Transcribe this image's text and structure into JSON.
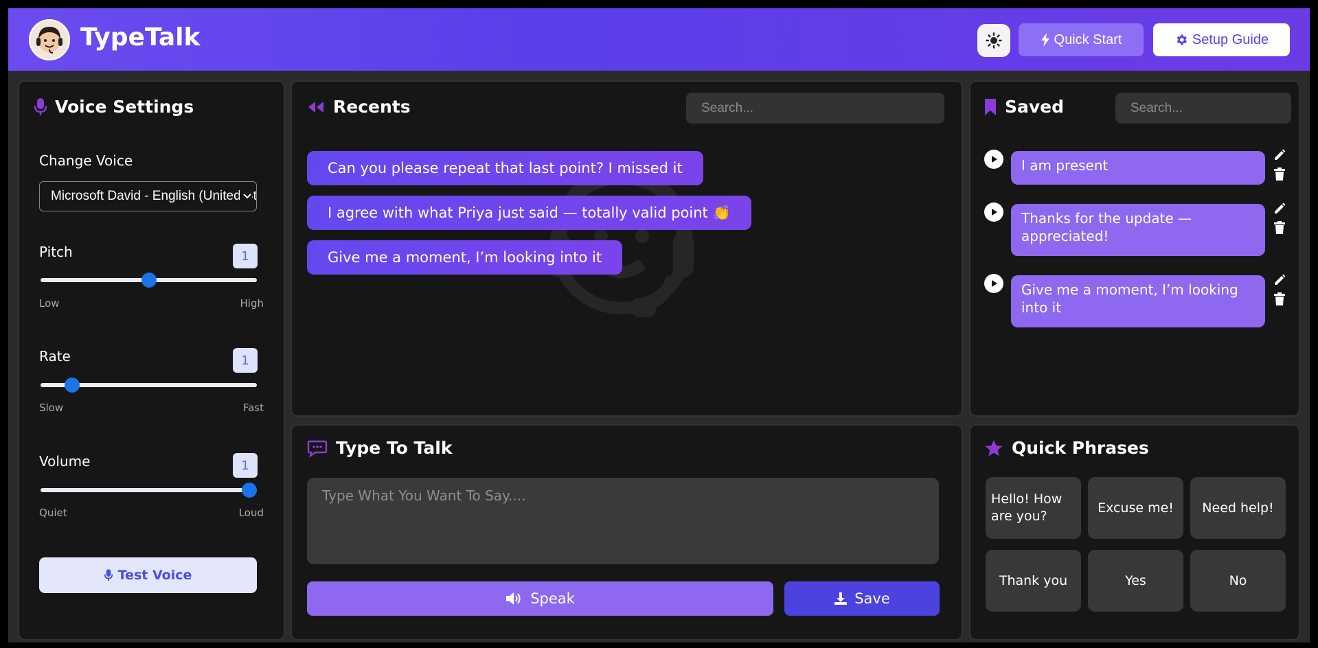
{
  "app": {
    "name": "TypeTalk"
  },
  "header": {
    "quick_start_label": "Quick Start",
    "setup_guide_label": "Setup Guide"
  },
  "voice_settings": {
    "title": "Voice Settings",
    "change_voice_label": "Change Voice",
    "selected_voice": "Microsoft David - English (United States)",
    "pitch": {
      "label": "Pitch",
      "value": "1",
      "level": 0.5,
      "low": "Low",
      "high": "High"
    },
    "rate": {
      "label": "Rate",
      "value": "1",
      "level": 0.12,
      "low": "Slow",
      "high": "Fast"
    },
    "volume": {
      "label": "Volume",
      "value": "1",
      "level": 1.0,
      "low": "Quiet",
      "high": "Loud"
    },
    "test_voice_label": "Test Voice"
  },
  "recents": {
    "title": "Recents",
    "search_placeholder": "Search...",
    "items": [
      "Can you please repeat that last point? I missed it",
      "I agree with what Priya just said — totally valid point 👏",
      "Give me a moment, I’m looking into it"
    ]
  },
  "saved": {
    "title": "Saved",
    "search_placeholder": "Search...",
    "items": [
      "I am present",
      "Thanks for the update — appreciated!",
      "Give me a moment, I’m looking into it"
    ]
  },
  "type_to_talk": {
    "title": "Type To Talk",
    "placeholder": "Type What You Want To Say....",
    "speak_label": "Speak",
    "save_label": "Save"
  },
  "quick_phrases": {
    "title": "Quick Phrases",
    "items": [
      "Hello! How are you?",
      "Excuse me!",
      "Need help!",
      "Thank you",
      "Yes",
      "No"
    ]
  },
  "colors": {
    "accent": "#6c4cf0",
    "accent_light": "#8e68ee",
    "icon_purple": "#8a3bd8",
    "slider_thumb": "#1a73e8",
    "panel_bg": "#161616"
  }
}
